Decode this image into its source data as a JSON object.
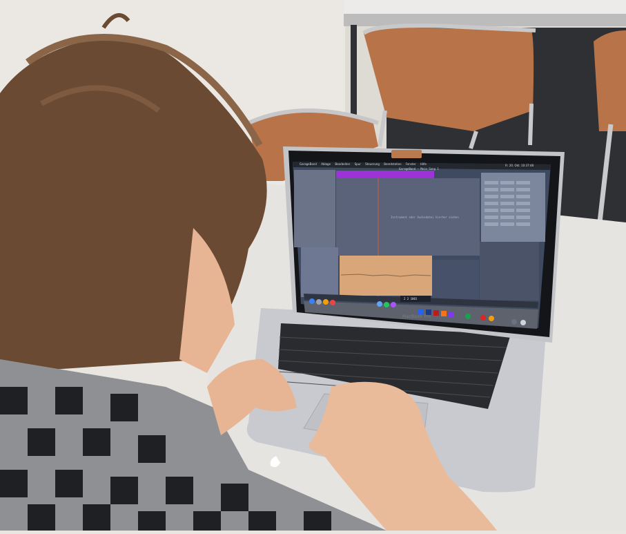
{
  "scene": {
    "description_tags": [
      "person-at-laptop",
      "macbook-pro",
      "garageband"
    ],
    "colors": {
      "wall": "#ece9e4",
      "table": "#e8e6e2",
      "floor": "#2c2e32",
      "chair_wicker": "#b9774a",
      "hair": "#6a4a34",
      "shirt_dark": "#1e1f22",
      "shirt_light": "#9a9a9e",
      "skin": "#e8b99a",
      "laptop_silver": "#c9cbcf",
      "screen_bg": "#3f4c63",
      "region_purple": "#9b33d6",
      "region_orange": "#d9a67a",
      "region_dark": "#5a6177",
      "dock_bg": "#5b5f6a"
    }
  },
  "laptop": {
    "brand_label": "MacBook Pro",
    "screen": {
      "app_menu": [
        "GarageBand",
        "Ablage",
        "Bearbeiten",
        "Spur",
        "Steuerung",
        "Bereitstellen",
        "Fenster",
        "Hilfe"
      ],
      "window_title": "GarageBand – Mein Song 1",
      "clock": "Fr. 20. Okt. 10:37:48",
      "lcd_display": "2 2 1001",
      "editor_hint": "Instrument oder Audiodatei hierher ziehen"
    }
  }
}
